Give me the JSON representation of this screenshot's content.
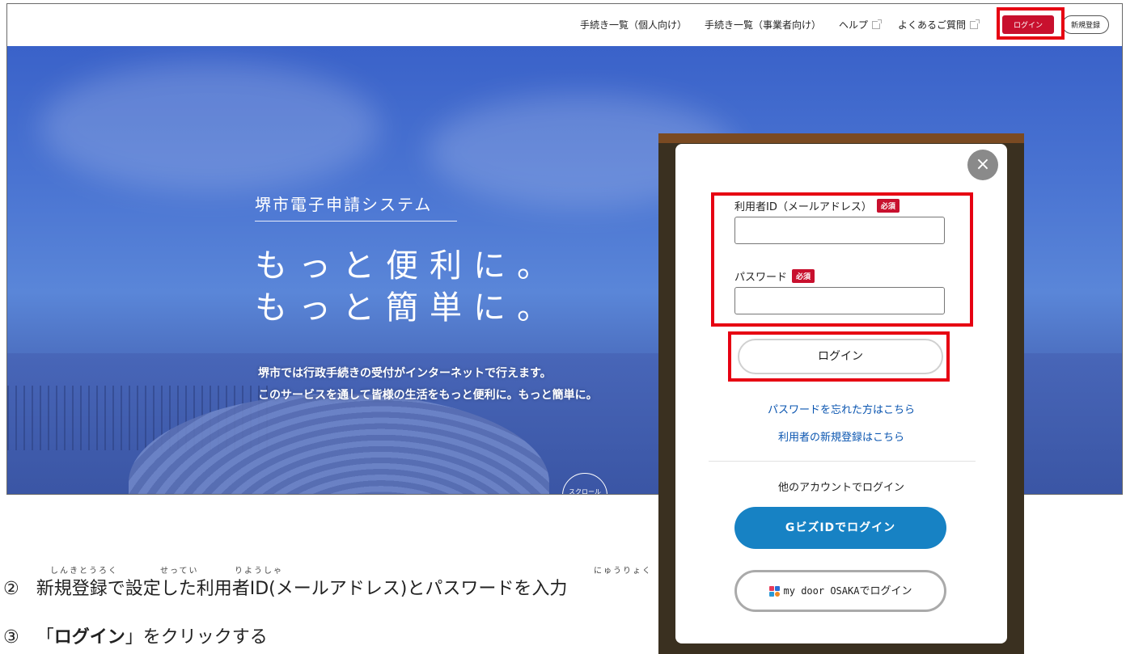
{
  "nav": {
    "links": [
      "手続き一覧（個人向け）",
      "手続き一覧（事業者向け）",
      "ヘルプ",
      "よくあるご質問"
    ],
    "login_label": "ログイン",
    "register_label": "新規登録"
  },
  "hero": {
    "subtitle": "堺市電子申請システム",
    "title_line1": "もっと便利に。",
    "title_line2": "もっと簡単に。",
    "desc_line1": "堺市では行政手続きの受付がインターネットで行えます。",
    "desc_line2": "このサービスを通して皆様の生活をもっと便利に。もっと簡単に。",
    "scroll_label": "スクロール"
  },
  "modal": {
    "close_symbol": "×",
    "user_id_label": "利用者ID（メールアドレス）",
    "required_badge": "必須",
    "password_label": "パスワード",
    "login_button": "ログイン",
    "forgot_password_link": "パスワードを忘れた方はこちら",
    "register_link": "利用者の新規登録はこちら",
    "other_accounts_label": "他のアカウントでログイン",
    "gbiz_button": "GビズIDでログイン",
    "mydoor_button_prefix": "my door OSAKA",
    "mydoor_button_suffix": "でログイン"
  },
  "instructions": {
    "step2_number": "②",
    "step2_text": "新規登録で設定した利用者ID(メールアドレス)とパスワードを入力",
    "step2_ruby_shinkitouroku": "しんきとうろく",
    "step2_ruby_settei": "せってい",
    "step2_ruby_riyousha": "りようしゃ",
    "step2_ruby_nyuuryoku": "にゅうりょく",
    "step3_number": "③",
    "step3_open": "「",
    "step3_bold": "ログイン",
    "step3_rest": "」をクリックする"
  },
  "colors": {
    "brand_red": "#c8102e",
    "highlight_red": "#e60012",
    "link_blue": "#0a55b0",
    "gbiz_blue": "#1782c4"
  }
}
